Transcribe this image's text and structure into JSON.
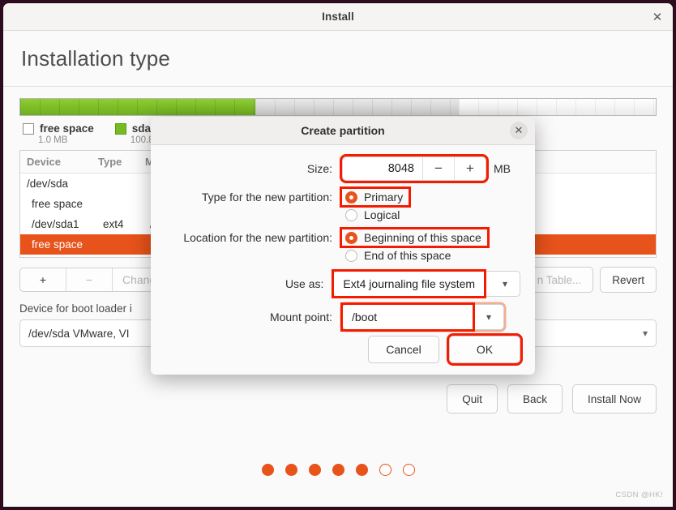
{
  "window": {
    "title": "Install",
    "close_icon": "close-icon",
    "page_title": "Installation type"
  },
  "partition_bar": {
    "segments": [
      {
        "name": "sda1",
        "percent": 37,
        "kind": "used"
      },
      {
        "name": "free space",
        "percent": 32,
        "kind": "freespace"
      },
      {
        "name": "unallocated",
        "percent": 31,
        "kind": "tail"
      }
    ]
  },
  "legend": [
    {
      "label": "free space",
      "size": "1.0 MB",
      "color": "#ffffff"
    },
    {
      "label": "sda1",
      "size": "100.8",
      "color": "#77bb22"
    }
  ],
  "device_table": {
    "headers": [
      "Device",
      "Type",
      "Mo",
      "",
      "",
      ""
    ],
    "rows": [
      {
        "device": "/dev/sda",
        "type": "",
        "mount": "",
        "selected": false,
        "indent": false
      },
      {
        "device": "free space",
        "type": "",
        "mount": "",
        "selected": false,
        "indent": true
      },
      {
        "device": "/dev/sda1",
        "type": "ext4",
        "mount": "/",
        "selected": false,
        "indent": true
      },
      {
        "device": "free space",
        "type": "",
        "mount": "",
        "selected": true,
        "indent": true
      }
    ]
  },
  "toolbar": {
    "add_label": "+",
    "remove_label": "−",
    "change_label": "Change...",
    "table_label": "n Table...",
    "revert_label": "Revert"
  },
  "boot_loader": {
    "label": "Device for boot loader i",
    "value": "/dev/sda   VMware, VI",
    "chevron_icon": "chevron-down-icon"
  },
  "actions": {
    "quit": "Quit",
    "back": "Back",
    "install_now": "Install Now"
  },
  "progress_dots": {
    "total": 7,
    "filled": 5,
    "color": "#e8521b"
  },
  "watermark": "CSDN @HK!",
  "dialog": {
    "title": "Create partition",
    "close_icon": "close-icon",
    "size": {
      "label": "Size:",
      "value": "8048",
      "unit": "MB",
      "minus_label": "−",
      "plus_label": "+"
    },
    "type": {
      "label": "Type for the new partition:",
      "options": [
        {
          "label": "Primary",
          "selected": true
        },
        {
          "label": "Logical",
          "selected": false
        }
      ]
    },
    "location": {
      "label": "Location for the new partition:",
      "options": [
        {
          "label": "Beginning of this space",
          "selected": true
        },
        {
          "label": "End of this space",
          "selected": false
        }
      ]
    },
    "use_as": {
      "label": "Use as:",
      "value": "Ext4 journaling file system",
      "chevron_icon": "chevron-down-icon"
    },
    "mount_point": {
      "label": "Mount point:",
      "value": "/boot",
      "chevron_icon": "chevron-down-icon"
    },
    "cancel": "Cancel",
    "ok": "OK"
  }
}
